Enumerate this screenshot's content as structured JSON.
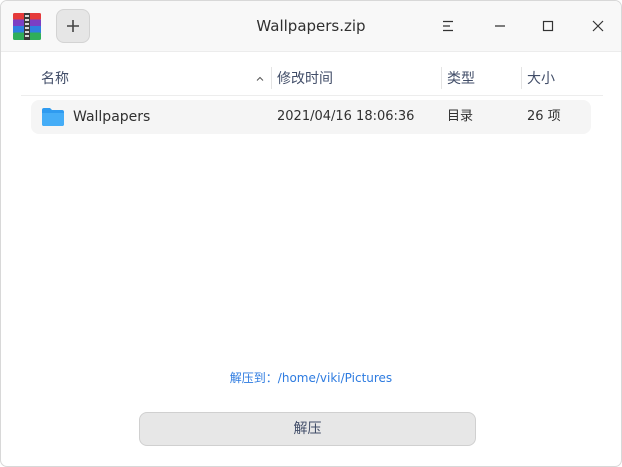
{
  "window": {
    "title": "Wallpapers.zip"
  },
  "titlebar": {
    "app_icon": "archive-manager-icon",
    "add_icon": "plus-icon",
    "menu_icon": "hamburger-menu-icon",
    "minimize_icon": "minimize-icon",
    "maximize_icon": "maximize-icon",
    "close_icon": "close-icon"
  },
  "table": {
    "headers": {
      "name": "名称",
      "modified": "修改时间",
      "type": "类型",
      "size": "大小"
    },
    "sort_icon": "chevron-up-icon",
    "rows": [
      {
        "icon": "folder-icon",
        "name": "Wallpapers",
        "modified": "2021/04/16 18:06:36",
        "type": "目录",
        "size": "26 项"
      }
    ]
  },
  "footer": {
    "extract_path": "解压到：/home/viki/Pictures",
    "extract_button": "解压"
  },
  "colors": {
    "accent": "#2d7be0",
    "folder": "#2f9bf0",
    "row_bg": "#f5f5f5",
    "button_bg": "#e7e7e7"
  }
}
